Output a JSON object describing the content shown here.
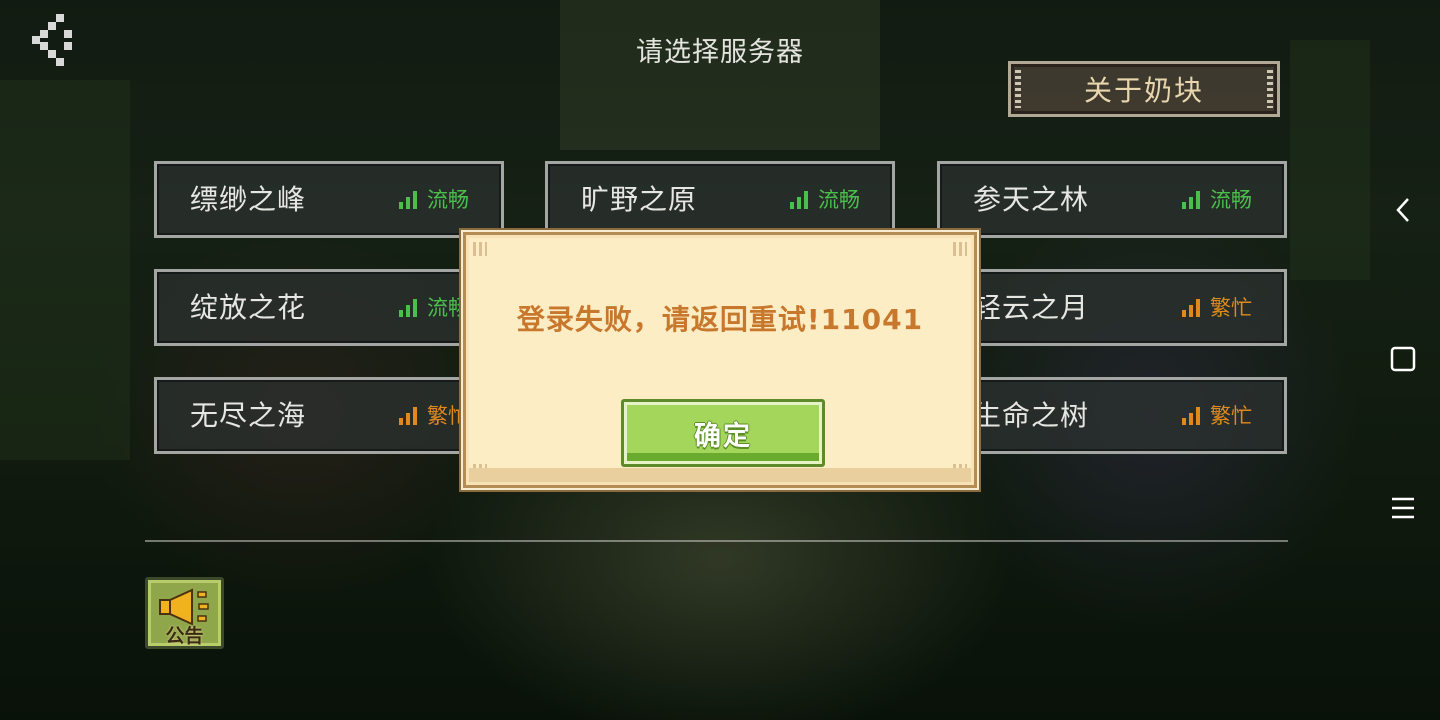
{
  "header": {
    "title": "请选择服务器",
    "about_label": "关于奶块"
  },
  "servers": [
    {
      "name": "缥缈之峰",
      "status": "流畅",
      "load": "good"
    },
    {
      "name": "旷野之原",
      "status": "流畅",
      "load": "good"
    },
    {
      "name": "参天之林",
      "status": "流畅",
      "load": "good"
    },
    {
      "name": "绽放之花",
      "status": "流畅",
      "load": "good"
    },
    {
      "name": "轻云之月",
      "status": "繁忙",
      "load": "busy"
    },
    {
      "name": "无尽之海",
      "status": "繁忙",
      "load": "busy"
    },
    {
      "name": "生命之树",
      "status": "繁忙",
      "load": "busy"
    }
  ],
  "dialog": {
    "message": "登录失败，请返回重试!11041",
    "confirm_label": "确定"
  },
  "notice": {
    "label": "公告"
  },
  "colors": {
    "status_good": "#4bbf4b",
    "status_busy": "#e08a1e",
    "dialog_text": "#c8782d",
    "confirm_green": "#a3d65b"
  },
  "icons": [
    "back-arrow-icon",
    "signal-bars-icon",
    "megaphone-icon",
    "nav-back-icon",
    "nav-home-icon",
    "nav-menu-icon"
  ]
}
